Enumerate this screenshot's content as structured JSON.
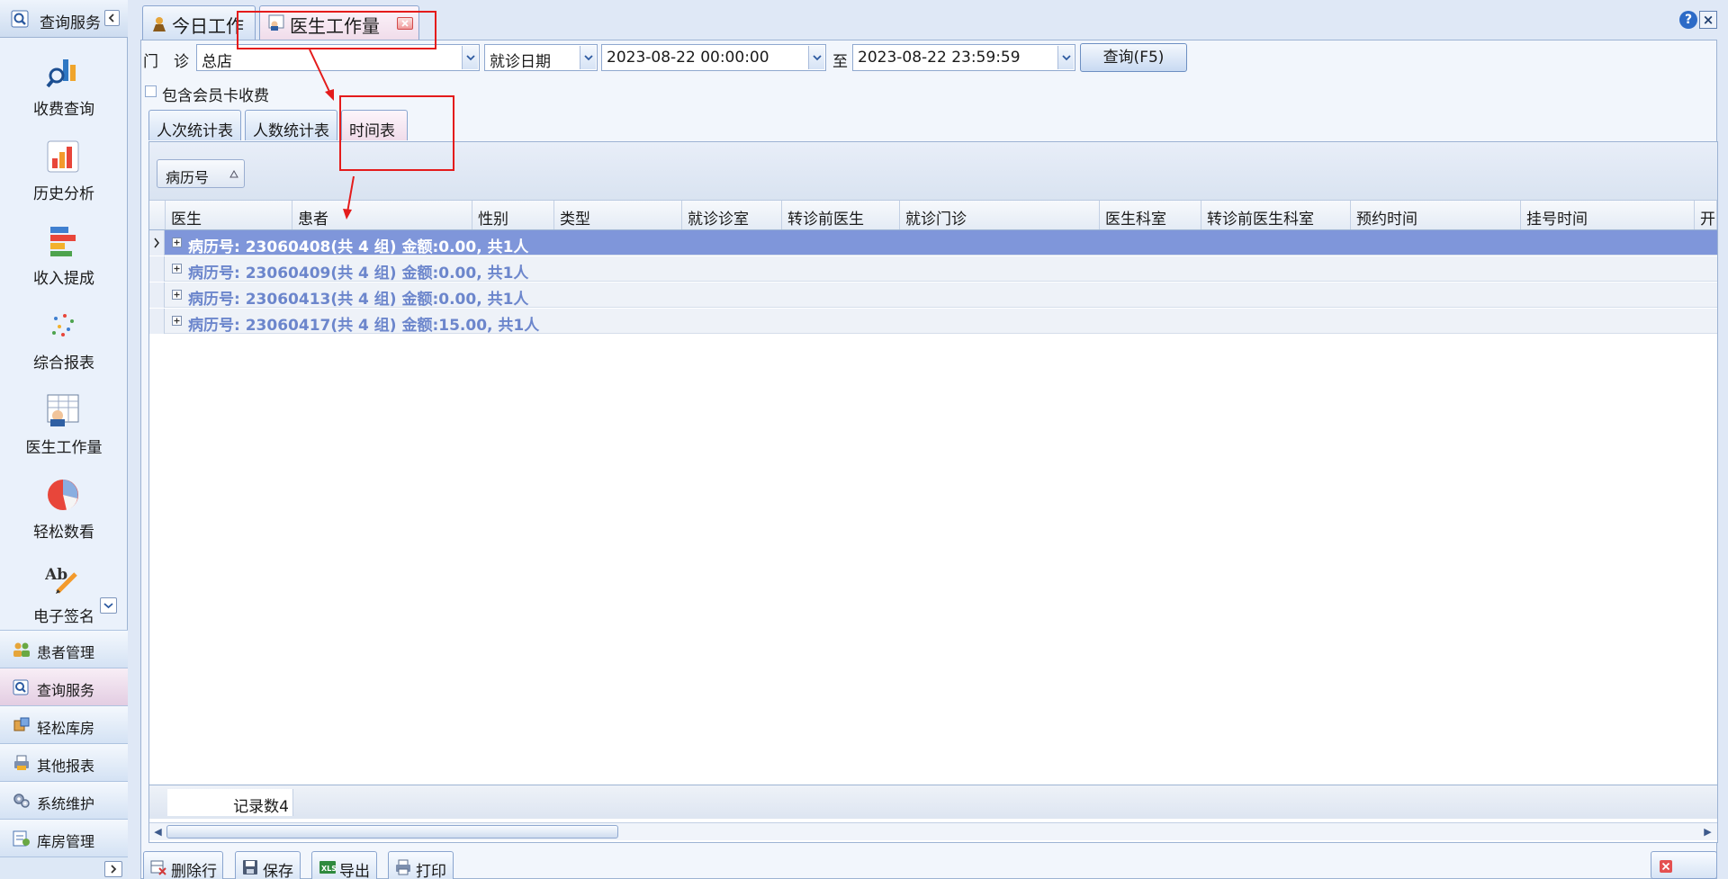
{
  "sidebar": {
    "header_title": "查询服务",
    "items": [
      {
        "label": "收费查询",
        "icon": "magnifier-chart-icon"
      },
      {
        "label": "历史分析",
        "icon": "bar-chart-icon"
      },
      {
        "label": "收入提成",
        "icon": "stacked-bars-icon"
      },
      {
        "label": "综合报表",
        "icon": "dots-report-icon"
      },
      {
        "label": "医生工作量",
        "icon": "doctor-board-icon"
      },
      {
        "label": "轻松数看",
        "icon": "pie-chart-icon"
      },
      {
        "label": "电子签名",
        "icon": "signature-pen-icon"
      }
    ],
    "nav": [
      {
        "label": "患者管理",
        "icon": "patients-icon"
      },
      {
        "label": "查询服务",
        "icon": "query-icon",
        "active": true
      },
      {
        "label": "轻松库房",
        "icon": "boxes-icon"
      },
      {
        "label": "其他报表",
        "icon": "printer-report-icon"
      },
      {
        "label": "系统维护",
        "icon": "gears-icon"
      },
      {
        "label": "库房管理",
        "icon": "warehouse-icon"
      }
    ]
  },
  "tabs": {
    "today": "今日工作",
    "workload": "医生工作量"
  },
  "filters": {
    "clinic_label": "门　诊",
    "clinic_value": "总店",
    "date_type": "就诊日期",
    "start": "2023-08-22 00:00:00",
    "to_label": "至",
    "end": "2023-08-22 23:59:59",
    "query_button": "查询(F5)",
    "member_label": "包含会员卡收费"
  },
  "inner_tabs": [
    "人次统计表",
    "人数统计表",
    "时间表"
  ],
  "grid": {
    "group_chip": "病历号",
    "columns": [
      "医生",
      "患者",
      "性别",
      "类型",
      "就诊诊室",
      "转诊前医生",
      "就诊门诊",
      "医生科室",
      "转诊前医生科室",
      "预约时间",
      "挂号时间",
      "开"
    ],
    "groups": [
      "病历号: 23060408(共 4 组) 金额:0.00, 共1人",
      "病历号: 23060409(共 4 组) 金额:0.00, 共1人",
      "病历号: 23060413(共 4 组) 金额:0.00, 共1人",
      "病历号: 23060417(共 4 组) 金额:15.00, 共1人"
    ],
    "footer": "记录数4"
  },
  "toolbar": {
    "delete": "删除行",
    "save": "保存",
    "export": "导出",
    "print": "打印"
  },
  "colors": {
    "selected_row": "#7f96da",
    "group_text": "#6c86cc",
    "annotation": "#e41b1b"
  }
}
